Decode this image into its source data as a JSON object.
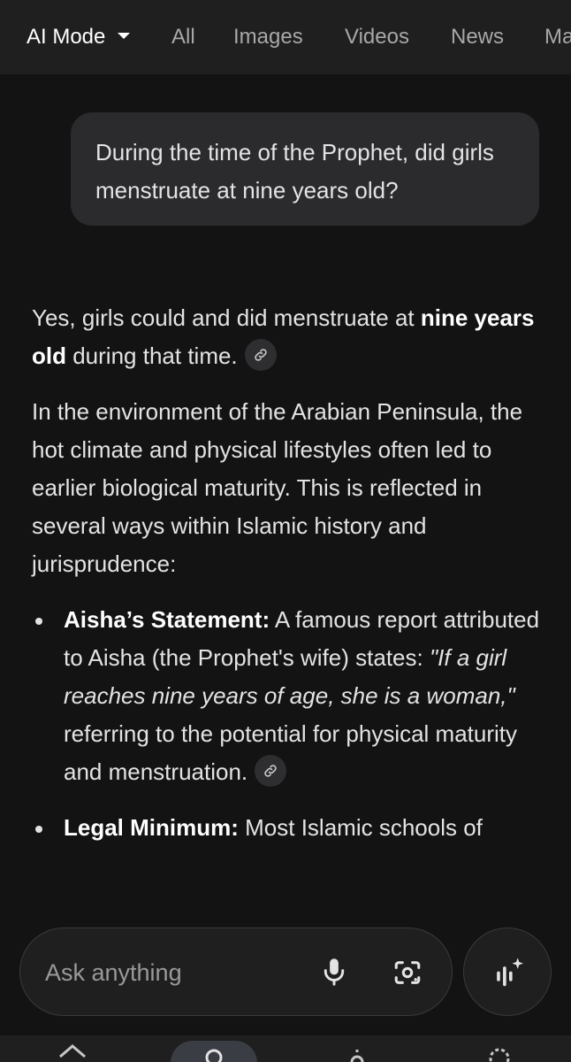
{
  "tabs": [
    {
      "label": "AI Mode",
      "active": true
    },
    {
      "label": "All"
    },
    {
      "label": "Images"
    },
    {
      "label": "Videos"
    },
    {
      "label": "News"
    },
    {
      "label": "Ma"
    }
  ],
  "user_query": "During the time of the Prophet, did girls menstruate at nine years old?",
  "answer": {
    "p1_a": "Yes, girls could and did menstruate at ",
    "p1_bold": "nine years old",
    "p1_b": " during that time.",
    "p2": "In the environment of the Arabian Peninsula, the hot climate and physical lifestyles often led to earlier biological maturity. This is reflected in several ways within Islamic history and jurisprudence:",
    "bullets": [
      {
        "title": "Aisha’s Statement:",
        "text_a": " A famous report attributed to Aisha (the Prophet's wife) states: ",
        "quote": "\"If a girl reaches nine years of age, she is a woman,\"",
        "text_b": " referring to the potential for physical maturity and menstruation."
      },
      {
        "title": "Legal Minimum:",
        "text_a": " Most Islamic schools of"
      }
    ]
  },
  "ask": {
    "placeholder": "Ask anything"
  },
  "icons": {
    "link": "link-icon",
    "mic": "mic-icon",
    "lens": "lens-camera-icon",
    "voice": "voice-sparkle-icon"
  },
  "colors": {
    "background": "#131314",
    "bubble": "#2b2b2e",
    "text": "#e3e3e3"
  }
}
